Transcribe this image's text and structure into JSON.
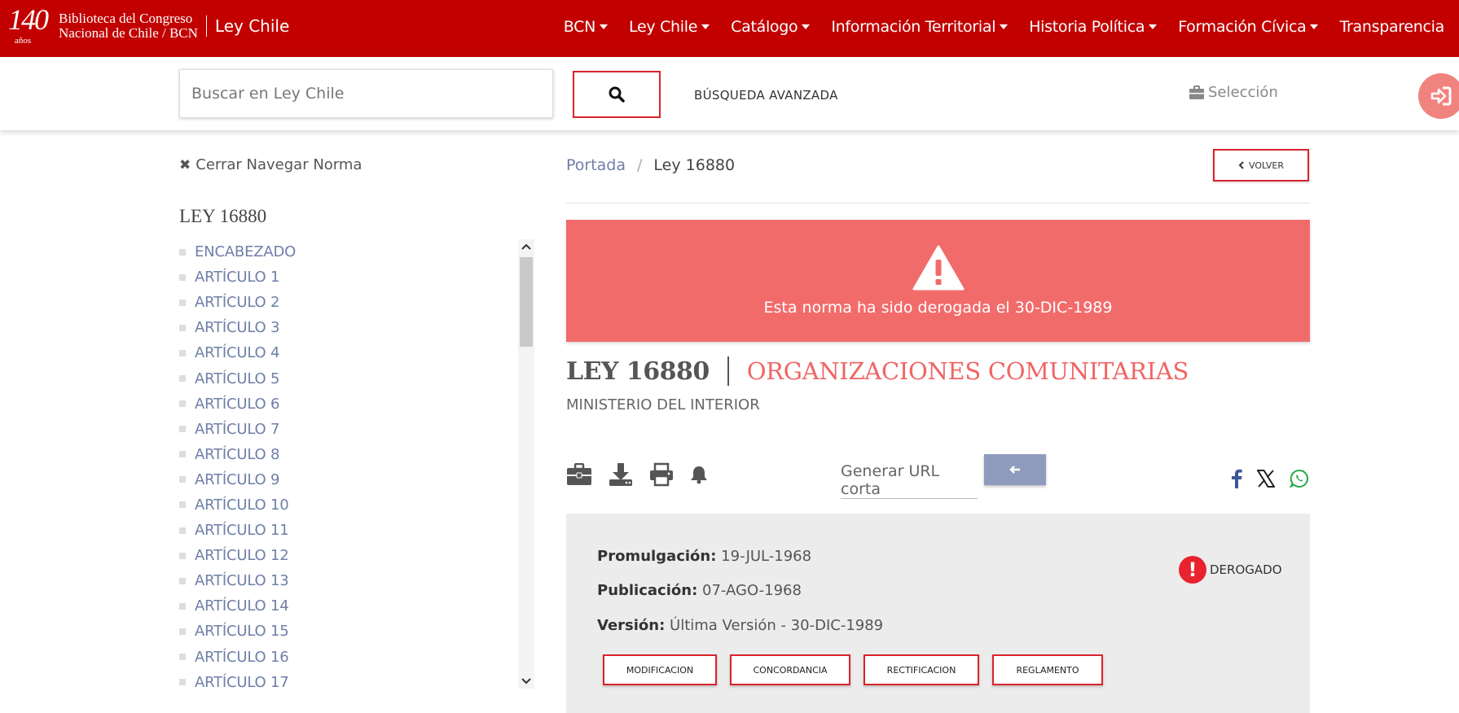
{
  "header": {
    "logo_number": "140",
    "logo_sub": "años",
    "institution_line1": "Biblioteca del Congreso",
    "institution_line2": "Nacional de Chile / BCN",
    "site_name": "Ley Chile",
    "bg_color": "#c20000",
    "nav": [
      {
        "label": "BCN",
        "dropdown": true
      },
      {
        "label": "Ley Chile",
        "dropdown": true
      },
      {
        "label": "Catálogo",
        "dropdown": true
      },
      {
        "label": "Información Territorial",
        "dropdown": true
      },
      {
        "label": "Historia Política",
        "dropdown": true
      },
      {
        "label": "Formación Cívica",
        "dropdown": true
      },
      {
        "label": "Transparencia",
        "dropdown": false
      }
    ]
  },
  "search": {
    "placeholder": "Buscar en Ley Chile",
    "value": "",
    "button_icon": "search-icon",
    "advanced_label": "BÚSQUEDA AVANZADA",
    "selection_label": "Selección"
  },
  "sidebar": {
    "close_label": "Cerrar Navegar Norma",
    "title": "LEY 16880",
    "items": [
      "ENCABEZADO",
      "ARTÍCULO 1",
      "ARTÍCULO 2",
      "ARTÍCULO 3",
      "ARTÍCULO 4",
      "ARTÍCULO 5",
      "ARTÍCULO 6",
      "ARTÍCULO 7",
      "ARTÍCULO 8",
      "ARTÍCULO 9",
      "ARTÍCULO 10",
      "ARTÍCULO 11",
      "ARTÍCULO 12",
      "ARTÍCULO 13",
      "ARTÍCULO 14",
      "ARTÍCULO 15",
      "ARTÍCULO 16",
      "ARTÍCULO 17"
    ]
  },
  "breadcrumb": {
    "home": "Portada",
    "separator": "/",
    "current": "Ley 16880"
  },
  "back_button": "VOLVER",
  "alert": {
    "text": "Esta norma ha sido derogada el 30-DIC-1989",
    "color": "#f26b6b"
  },
  "law": {
    "number": "LEY 16880",
    "name": "ORGANIZACIONES COMUNITARIAS",
    "ministry": "MINISTERIO DEL INTERIOR"
  },
  "tools": {
    "icons": [
      "briefcase-icon",
      "download-icon",
      "print-icon",
      "bell-icon"
    ],
    "short_url_label": "Generar URL corta",
    "share": [
      "facebook-icon",
      "x-icon",
      "whatsapp-icon"
    ]
  },
  "info": {
    "promulgacion_label": "Promulgación:",
    "promulgacion_value": "19-JUL-1968",
    "publicacion_label": "Publicación:",
    "publicacion_value": "07-AGO-1968",
    "version_label": "Versión:",
    "version_value": "Última Versión - 30-DIC-1989",
    "status": "DEROGADO",
    "buttons": [
      "MODIFICACION",
      "CONCORDANCIA",
      "RECTIFICACION",
      "REGLAMENTO"
    ]
  }
}
